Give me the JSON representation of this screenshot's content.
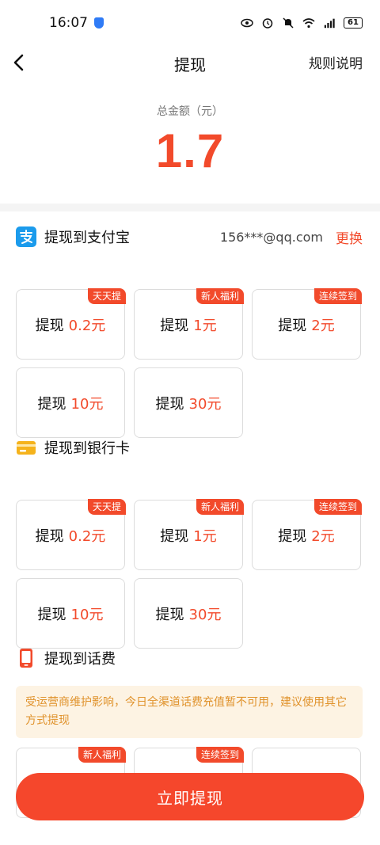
{
  "status_bar": {
    "time": "16:07",
    "battery": "61",
    "icons": [
      "shield-icon",
      "eye-icon",
      "alarm-icon",
      "mute-icon",
      "wifi-icon",
      "signal-5g-icon",
      "battery-icon"
    ]
  },
  "header": {
    "title": "提现",
    "rules_label": "规则说明",
    "back_icon": "chevron-left-icon"
  },
  "balance": {
    "label": "总金额（元）",
    "amount": "1.7"
  },
  "sections": {
    "alipay": {
      "title": "提现到支付宝",
      "icon": "alipay-icon",
      "account": "156***@qq.com",
      "change_label": "更换",
      "options": [
        {
          "prefix": "提现",
          "amount": "0.2元",
          "badge": "天天提"
        },
        {
          "prefix": "提现",
          "amount": "1元",
          "badge": "新人福利"
        },
        {
          "prefix": "提现",
          "amount": "2元",
          "badge": "连续签到"
        },
        {
          "prefix": "提现",
          "amount": "10元",
          "badge": ""
        },
        {
          "prefix": "提现",
          "amount": "30元",
          "badge": ""
        }
      ]
    },
    "bank": {
      "title": "提现到银行卡",
      "icon": "bank-card-icon",
      "options": [
        {
          "prefix": "提现",
          "amount": "0.2元",
          "badge": "天天提"
        },
        {
          "prefix": "提现",
          "amount": "1元",
          "badge": "新人福利"
        },
        {
          "prefix": "提现",
          "amount": "2元",
          "badge": "连续签到"
        },
        {
          "prefix": "提现",
          "amount": "10元",
          "badge": ""
        },
        {
          "prefix": "提现",
          "amount": "30元",
          "badge": ""
        }
      ]
    },
    "phone": {
      "title": "提现到话费",
      "icon": "phone-icon",
      "notice": "受运营商维护影响，今日全渠道话费充值暂不可用，建议使用其它方式提现",
      "options": [
        {
          "badge": "新人福利"
        },
        {
          "badge": "连续签到"
        },
        {
          "badge": ""
        }
      ]
    }
  },
  "cta": {
    "label": "立即提现"
  },
  "colors": {
    "accent": "#f24a2b",
    "notice_bg": "#fdf3e3",
    "notice_text": "#e0922b"
  }
}
